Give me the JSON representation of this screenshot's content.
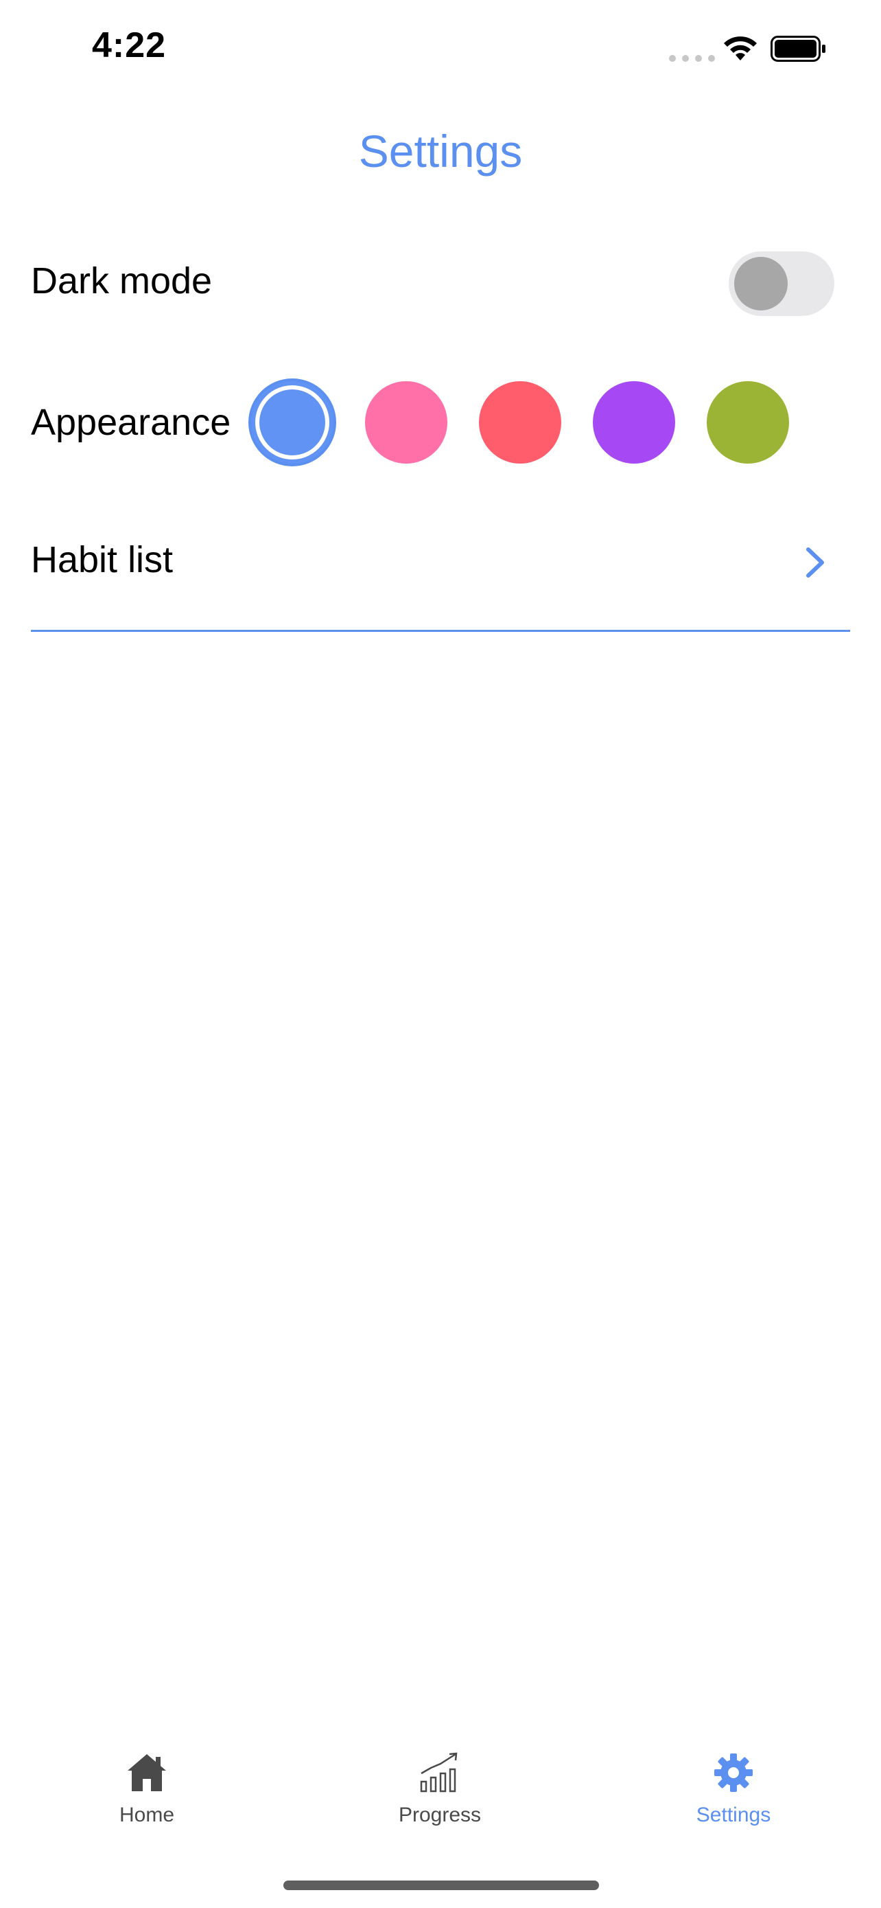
{
  "status_bar": {
    "time": "4:22"
  },
  "header": {
    "title": "Settings"
  },
  "settings": {
    "dark_mode": {
      "label": "Dark mode",
      "enabled": false
    },
    "appearance": {
      "label": "Appearance",
      "selected_index": 0,
      "colors": [
        "#6193f5",
        "#ff6fa8",
        "#ff5d6b",
        "#a649f5",
        "#9bb435"
      ]
    },
    "habit_list": {
      "label": "Habit list"
    }
  },
  "tab_bar": {
    "tabs": [
      {
        "label": "Home",
        "icon": "home-icon",
        "active": false
      },
      {
        "label": "Progress",
        "icon": "progress-chart-icon",
        "active": false
      },
      {
        "label": "Settings",
        "icon": "gear-icon",
        "active": true
      }
    ]
  },
  "colors": {
    "accent": "#5b8ff0",
    "toggle_track": "#e8e8ea",
    "toggle_knob": "#a7a7a7",
    "tab_inactive": "#4a4a4a"
  }
}
